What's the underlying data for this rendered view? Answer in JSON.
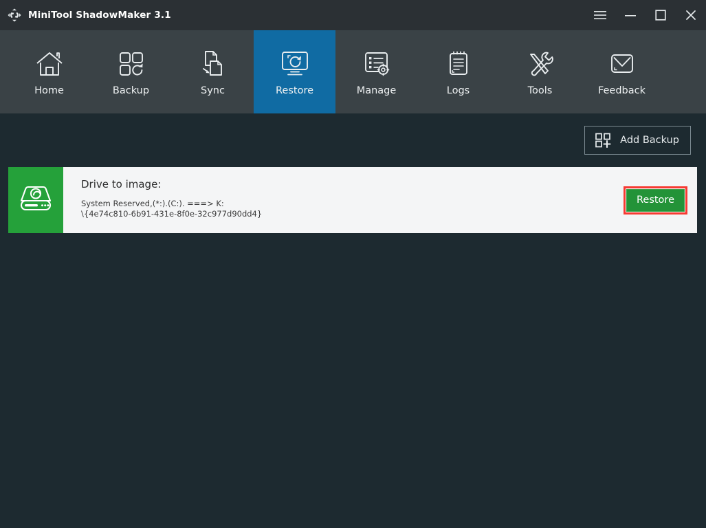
{
  "window": {
    "title": "MiniTool ShadowMaker 3.1",
    "app_icon": "sync-arrows-icon",
    "controls": [
      {
        "name": "menu-button",
        "icon": "hamburger-menu-icon"
      },
      {
        "name": "minimize-button",
        "icon": "minimize-icon"
      },
      {
        "name": "maximize-button",
        "icon": "maximize-icon"
      },
      {
        "name": "close-button",
        "icon": "close-icon"
      }
    ]
  },
  "nav": {
    "active": "Restore",
    "active_color": "#106ba3",
    "items": [
      {
        "label": "Home",
        "icon": "home-icon"
      },
      {
        "label": "Backup",
        "icon": "backup-squares-icon"
      },
      {
        "label": "Sync",
        "icon": "sync-files-icon"
      },
      {
        "label": "Restore",
        "icon": "monitor-refresh-icon"
      },
      {
        "label": "Manage",
        "icon": "list-gear-icon"
      },
      {
        "label": "Logs",
        "icon": "clipboard-icon"
      },
      {
        "label": "Tools",
        "icon": "tools-icon"
      },
      {
        "label": "Feedback",
        "icon": "envelope-icon"
      }
    ]
  },
  "toolbar": {
    "add_backup_label": "Add Backup",
    "add_backup_icon": "add-backup-icon"
  },
  "backups": [
    {
      "thumb_icon": "hard-drive-icon",
      "thumb_color": "#25a13a",
      "title": "Drive to image:",
      "details": "System Reserved,(*:).(C:). ===> K:\n\\{4e74c810-6b91-431e-8f0e-32c977d90dd4}",
      "action_label": "Restore",
      "action_color": "#239338",
      "highlight_color": "#f73a32"
    }
  ],
  "colors": {
    "titlebar_bg": "#2b3034",
    "navbar_bg": "#3a4246",
    "content_bg": "#1d2a30",
    "card_bg": "#f4f5f6"
  }
}
